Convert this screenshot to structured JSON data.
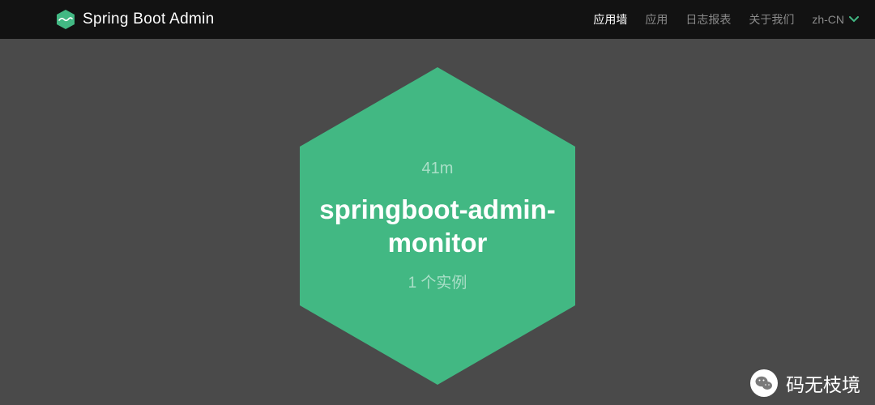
{
  "header": {
    "title": "Spring Boot Admin"
  },
  "nav": {
    "items": [
      {
        "label": "应用墙",
        "active": true
      },
      {
        "label": "应用",
        "active": false
      },
      {
        "label": "日志报表",
        "active": false
      },
      {
        "label": "关于我们",
        "active": false
      }
    ],
    "language": "zh-CN"
  },
  "wallboard": {
    "apps": [
      {
        "uptime": "41m",
        "name": "springboot-admin-monitor",
        "instances_label": "1 个实例",
        "status_color": "#42b883"
      }
    ]
  },
  "watermark": {
    "text": "码无枝境"
  }
}
